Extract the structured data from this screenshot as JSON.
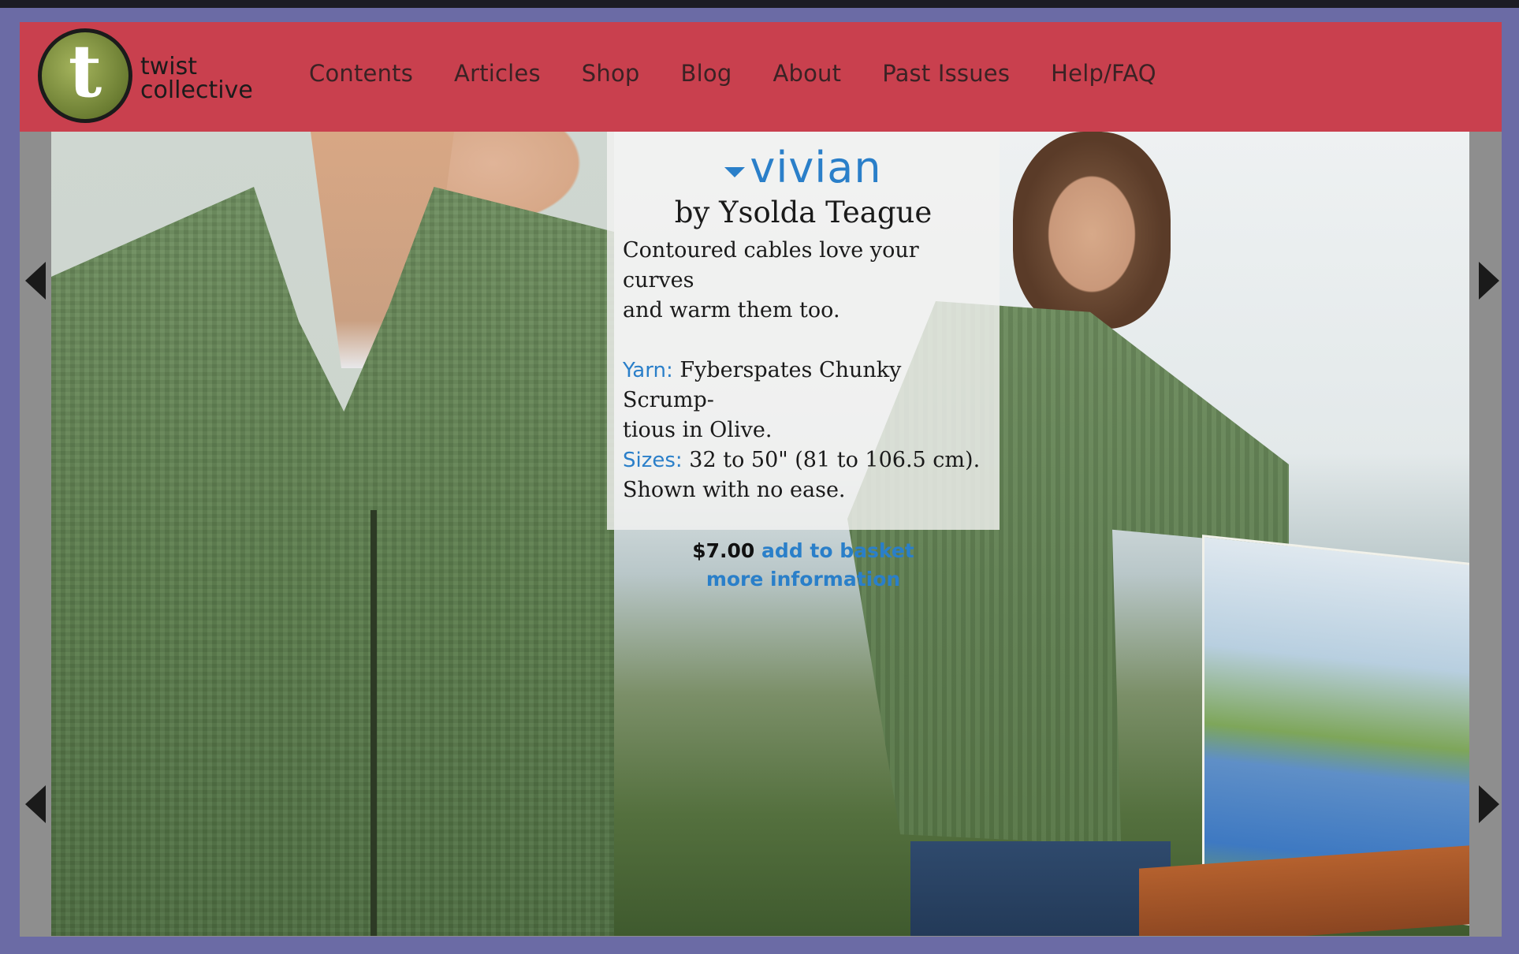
{
  "header": {
    "logo": {
      "letter": "t",
      "line1": "twist",
      "line2": "collective"
    },
    "nav": [
      {
        "label": "Contents"
      },
      {
        "label": "Articles"
      },
      {
        "label": "Shop"
      },
      {
        "label": "Blog"
      },
      {
        "label": "About"
      },
      {
        "label": "Past Issues"
      },
      {
        "label": "Help/FAQ"
      }
    ]
  },
  "pattern": {
    "title": "vivian",
    "byline": "by Ysolda Teague",
    "tagline_1": "Contoured cables love your curves",
    "tagline_2": "and warm them too.",
    "yarn_label": "Yarn:",
    "yarn_value_1": "Fyberspates Chunky Scrump-",
    "yarn_value_2": "tious in Olive.",
    "sizes_label": "Sizes:",
    "sizes_value": "32 to 50\" (81 to 106.5 cm).",
    "ease_note": "Shown with no ease.",
    "price": "$7.00",
    "add_to_basket": "add to basket",
    "more_information": "more information"
  },
  "colors": {
    "header_bg": "#c9404e",
    "page_bg": "#6b6ba5",
    "link_blue": "#2a7fc9"
  },
  "icons": {
    "prev_top": "caret-left-icon",
    "next_top": "caret-right-icon",
    "prev_bottom": "caret-left-icon",
    "next_bottom": "caret-right-icon",
    "title_caret": "caret-down-icon"
  }
}
